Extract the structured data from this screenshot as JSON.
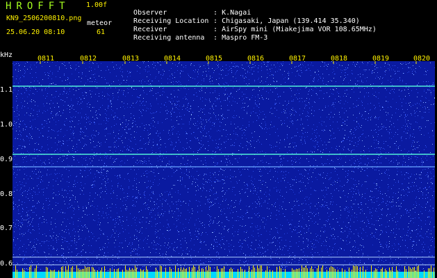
{
  "header": {
    "app_title": "HROFFT",
    "version": "1.00f",
    "filename": "KN9_2506200810.png",
    "meteor_label": "meteor",
    "datetime": "25.06.20 08:10",
    "meteor_count": "61"
  },
  "info": [
    {
      "label": "Observer",
      "value": ": K.Nagai"
    },
    {
      "label": "Receiving Location",
      "value": ": Chigasaki, Japan (139.414 35.340)"
    },
    {
      "label": "Receiver",
      "value": ": AirSpy mini (Miakejima VOR 108.65MHz)"
    },
    {
      "label": "Receiving antenna",
      "value": ": Maspro FM-3"
    }
  ],
  "axis": {
    "freq_unit": "kHz",
    "freq_ticks": [
      "1.1",
      "1.0",
      "0.9",
      "0.8",
      "0.7",
      "0.6"
    ],
    "time_ticks": [
      "0811",
      "0812",
      "0813",
      "0814",
      "0815",
      "0816",
      "0817",
      "0818",
      "0819",
      "0820"
    ]
  },
  "colors": {
    "background": "#0a1aa0",
    "trace": "#40e0d0",
    "bottom_band": "#00d8ff",
    "label_yellow": "#fff200",
    "label_green": "#a6ff1e"
  }
}
